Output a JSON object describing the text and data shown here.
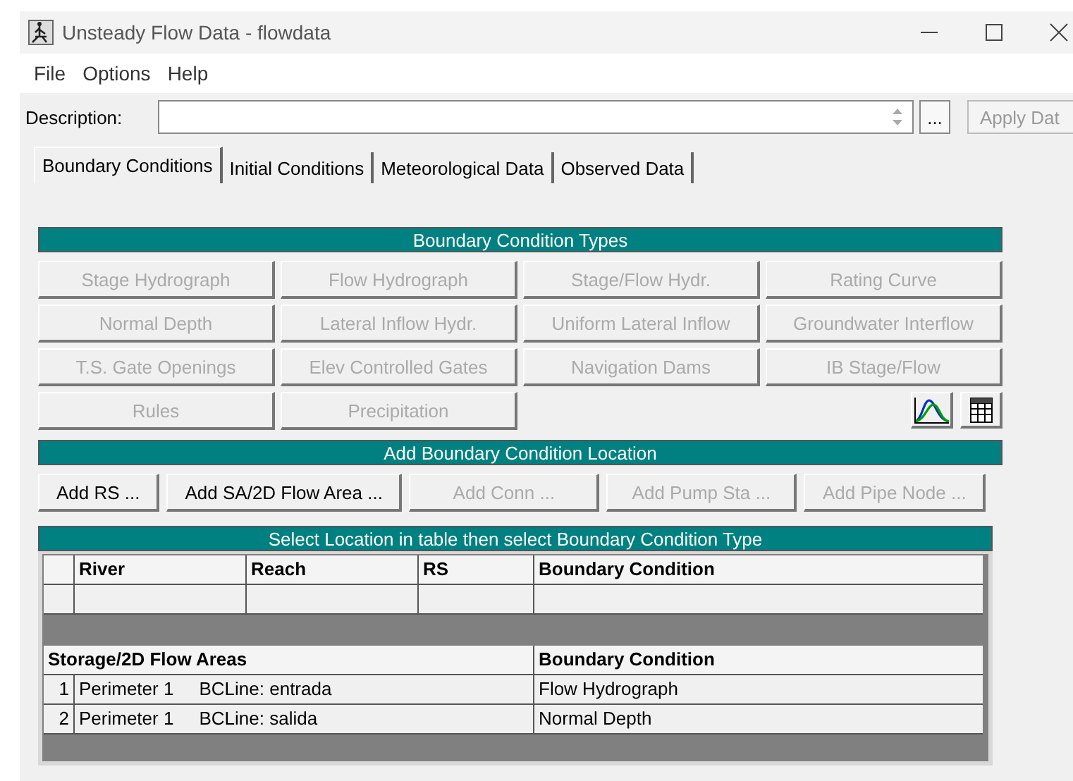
{
  "window": {
    "title": "Unsteady Flow Data - flowdata"
  },
  "menu": [
    "File",
    "Options",
    "Help"
  ],
  "description": {
    "label": "Description:",
    "browse": "...",
    "apply": "Apply Dat"
  },
  "tabs": [
    {
      "label": "Boundary Conditions",
      "selected": true
    },
    {
      "label": "Initial Conditions",
      "selected": false
    },
    {
      "label": "Meteorological Data",
      "selected": false
    },
    {
      "label": "Observed Data",
      "selected": false
    }
  ],
  "types": {
    "title": "Boundary Condition Types",
    "buttons": [
      {
        "label": "Stage Hydrograph",
        "disabled": true
      },
      {
        "label": "Flow Hydrograph",
        "disabled": true
      },
      {
        "label": "Stage/Flow Hydr.",
        "disabled": true
      },
      {
        "label": "Rating Curve",
        "disabled": true
      },
      {
        "label": "Normal Depth",
        "disabled": true
      },
      {
        "label": "Lateral Inflow Hydr.",
        "disabled": true
      },
      {
        "label": "Uniform Lateral Inflow",
        "disabled": true
      },
      {
        "label": "Groundwater Interflow",
        "disabled": true
      },
      {
        "label": "T.S. Gate Openings",
        "disabled": true
      },
      {
        "label": "Elev Controlled Gates",
        "disabled": true
      },
      {
        "label": "Navigation Dams",
        "disabled": true
      },
      {
        "label": "IB Stage/Flow",
        "disabled": true
      },
      {
        "label": "Rules",
        "disabled": true
      },
      {
        "label": "Precipitation",
        "disabled": true
      }
    ]
  },
  "location": {
    "title": "Add Boundary Condition Location",
    "buttons": [
      {
        "label": "Add RS ...",
        "disabled": false
      },
      {
        "label": "Add SA/2D Flow Area ...",
        "disabled": false
      },
      {
        "label": "Add Conn ...",
        "disabled": true
      },
      {
        "label": "Add Pump Sta ...",
        "disabled": true
      },
      {
        "label": "Add Pipe Node ...",
        "disabled": true
      }
    ]
  },
  "table": {
    "title": "Select Location in table then select Boundary Condition Type",
    "columns": [
      "River",
      "Reach",
      "RS",
      "Boundary Condition"
    ],
    "storage_columns": [
      "Storage/2D Flow Areas",
      "Boundary Condition"
    ],
    "storage_rows": [
      {
        "number": "1",
        "location": "Perimeter 1     BCLine: entrada",
        "boundary_condition": "Flow Hydrograph"
      },
      {
        "number": "2",
        "location": "Perimeter 1     BCLine: salida",
        "boundary_condition": "Normal Depth"
      }
    ]
  }
}
